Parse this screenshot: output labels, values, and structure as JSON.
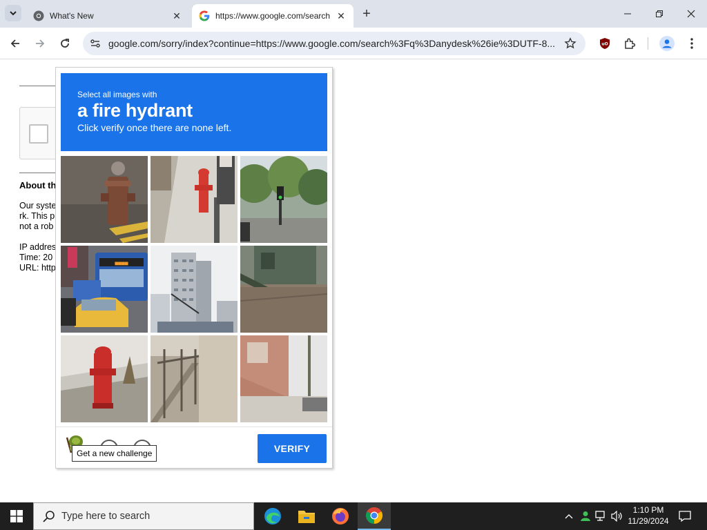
{
  "browser": {
    "tabs": [
      {
        "title": "What's New",
        "active": false
      },
      {
        "title": "https://www.google.com/search",
        "active": true
      }
    ],
    "address_bar": {
      "url": "google.com/sorry/index?continue=https://www.google.com/search%3Fq%3Danydesk%26ie%3DUTF-8..."
    }
  },
  "page": {
    "about_title": "About th",
    "about_text": "Our syste\nrk. This p\nnot a rob\n\nIP addres\nTime: 20\nURL: http"
  },
  "captcha": {
    "instruction_line1": "Select all images with",
    "target_object": "a fire hydrant",
    "instruction_line3": "Click verify once there are none left.",
    "tiles": [
      {
        "index": 1,
        "content": "fire hydrant on sidewalk"
      },
      {
        "index": 2,
        "content": "red fire hydrant near pedestrian"
      },
      {
        "index": 3,
        "content": "street with trees and traffic light"
      },
      {
        "index": 4,
        "content": "bus and taxi on street"
      },
      {
        "index": 5,
        "content": "tall apartment buildings"
      },
      {
        "index": 6,
        "content": "house with stairs"
      },
      {
        "index": 7,
        "content": "red fire hydrant"
      },
      {
        "index": 8,
        "content": "stairway railing"
      },
      {
        "index": 9,
        "content": "building with stairs"
      }
    ],
    "tooltip": "Get a new challenge",
    "verify_label": "VERIFY"
  },
  "taskbar": {
    "search_placeholder": "Type here to search",
    "time": "1:10 PM",
    "date": "11/29/2024"
  },
  "colors": {
    "captcha_blue": "#1a73e8",
    "tabstrip": "#dee3eb",
    "taskbar": "#1f1f1f"
  }
}
